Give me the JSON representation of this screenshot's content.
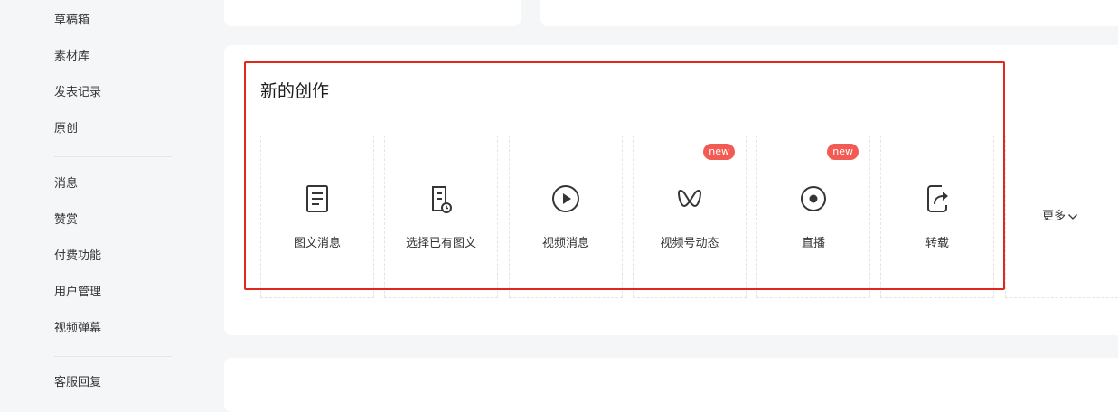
{
  "sidebar": {
    "items": [
      {
        "label": "草稿箱"
      },
      {
        "label": "素材库"
      },
      {
        "label": "发表记录"
      },
      {
        "label": "原创"
      },
      {
        "label": "消息"
      },
      {
        "label": "赞赏"
      },
      {
        "label": "付费功能"
      },
      {
        "label": "用户管理"
      },
      {
        "label": "视频弹幕"
      },
      {
        "label": "客服回复"
      }
    ]
  },
  "creation": {
    "title": "新的创作",
    "tiles": [
      {
        "label": "图文消息",
        "icon": "document-icon",
        "badge": ""
      },
      {
        "label": "选择已有图文",
        "icon": "document-clock-icon",
        "badge": ""
      },
      {
        "label": "视频消息",
        "icon": "play-icon",
        "badge": ""
      },
      {
        "label": "视频号动态",
        "icon": "channels-icon",
        "badge": "new"
      },
      {
        "label": "直播",
        "icon": "live-icon",
        "badge": "new"
      },
      {
        "label": "转载",
        "icon": "share-icon",
        "badge": ""
      }
    ],
    "more_label": "更多"
  },
  "colors": {
    "highlight": "#e0281e",
    "badge": "#f25a53"
  }
}
